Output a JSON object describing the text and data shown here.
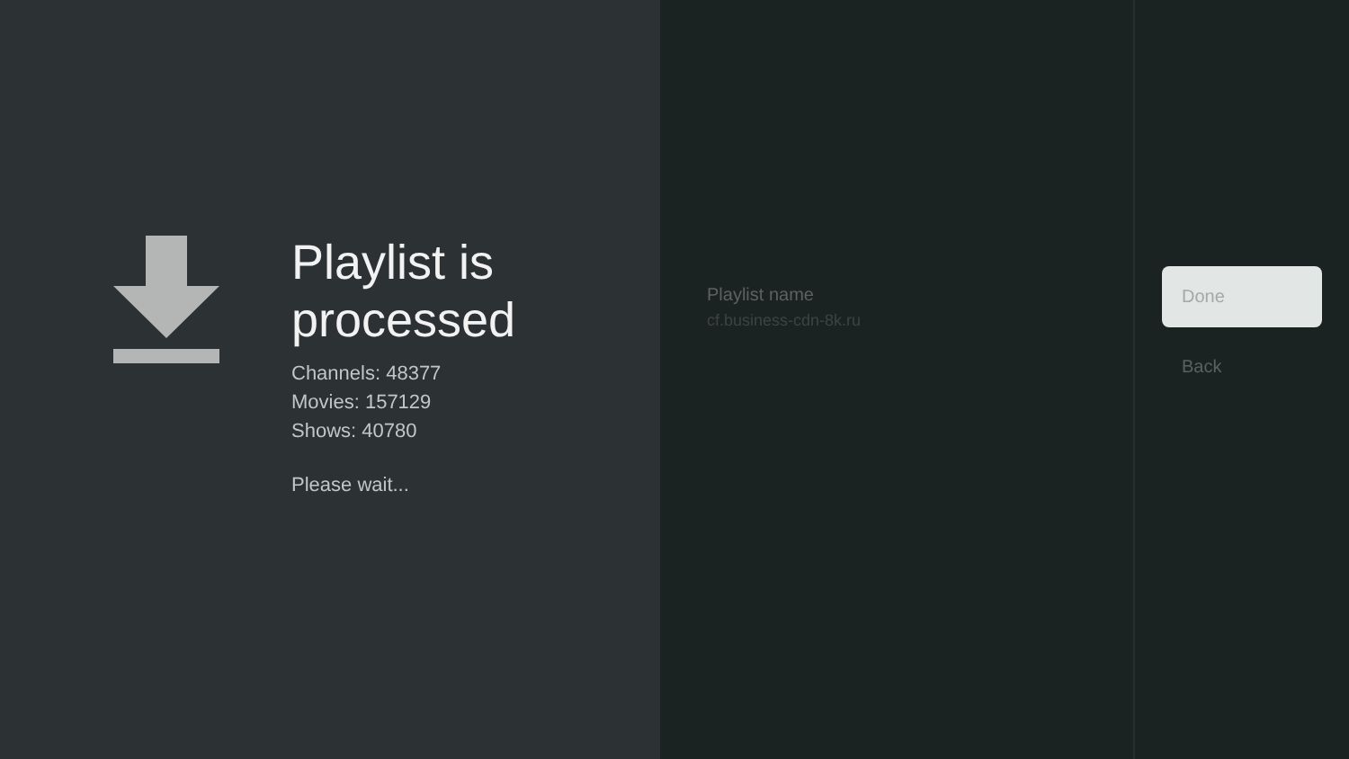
{
  "status": {
    "title": "Playlist is processed",
    "stats": [
      "Channels: 48377",
      "Movies: 157129",
      "Shows: 40780"
    ],
    "message": "Please wait..."
  },
  "playlist": {
    "label": "Playlist name",
    "value": "cf.business-cdn-8k.ru"
  },
  "actions": [
    {
      "label": "Done",
      "selected": true
    },
    {
      "label": "Back",
      "selected": false
    }
  ]
}
